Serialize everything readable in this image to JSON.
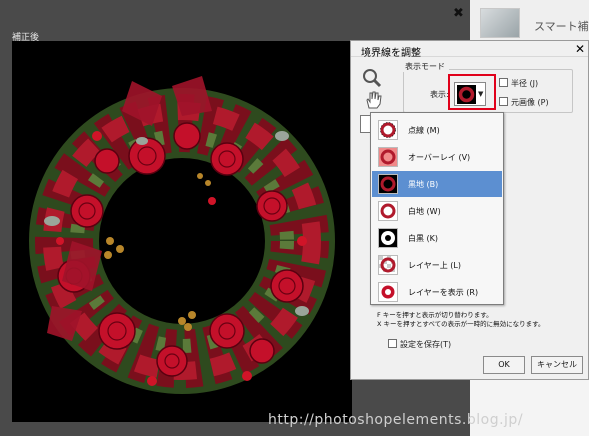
{
  "workspace": {
    "label": "補正後",
    "close_glyph": "✖"
  },
  "right_panel": {
    "smart_label": "スマート補正"
  },
  "dialog": {
    "title": "境界線を調整",
    "close_glyph": "✕",
    "group_title": "表示モード",
    "display_label": "表示:",
    "checkboxes": [
      {
        "label": "半径 (J)",
        "checked": false
      },
      {
        "label": "元画像 (P)",
        "checked": false
      }
    ],
    "menu_items": [
      {
        "label": "点線 (M)",
        "icon": "marching-ants-icon",
        "selected": false
      },
      {
        "label": "オーバーレイ (V)",
        "icon": "overlay-icon",
        "selected": false
      },
      {
        "label": "黒地 (B)",
        "icon": "on-black-icon",
        "selected": true
      },
      {
        "label": "白地 (W)",
        "icon": "on-white-icon",
        "selected": false
      },
      {
        "label": "白黒 (K)",
        "icon": "black-white-icon",
        "selected": false
      },
      {
        "label": "レイヤー上 (L)",
        "icon": "on-layers-icon",
        "selected": false
      },
      {
        "label": "レイヤーを表示 (R)",
        "icon": "reveal-layer-icon",
        "selected": false
      }
    ],
    "hints": [
      "F キーを押すと表示が切り替わります。",
      "X キーを押すとすべての表示が一時的に無効になります。"
    ],
    "save_settings_label": "設定を保存(T)",
    "ok_label": "OK",
    "cancel_label": "キャンセル"
  },
  "watermark": "http://photoshopelements.blog.jp/",
  "colors": {
    "selection": "#5c8fd1",
    "highlight": "#e0001a"
  }
}
